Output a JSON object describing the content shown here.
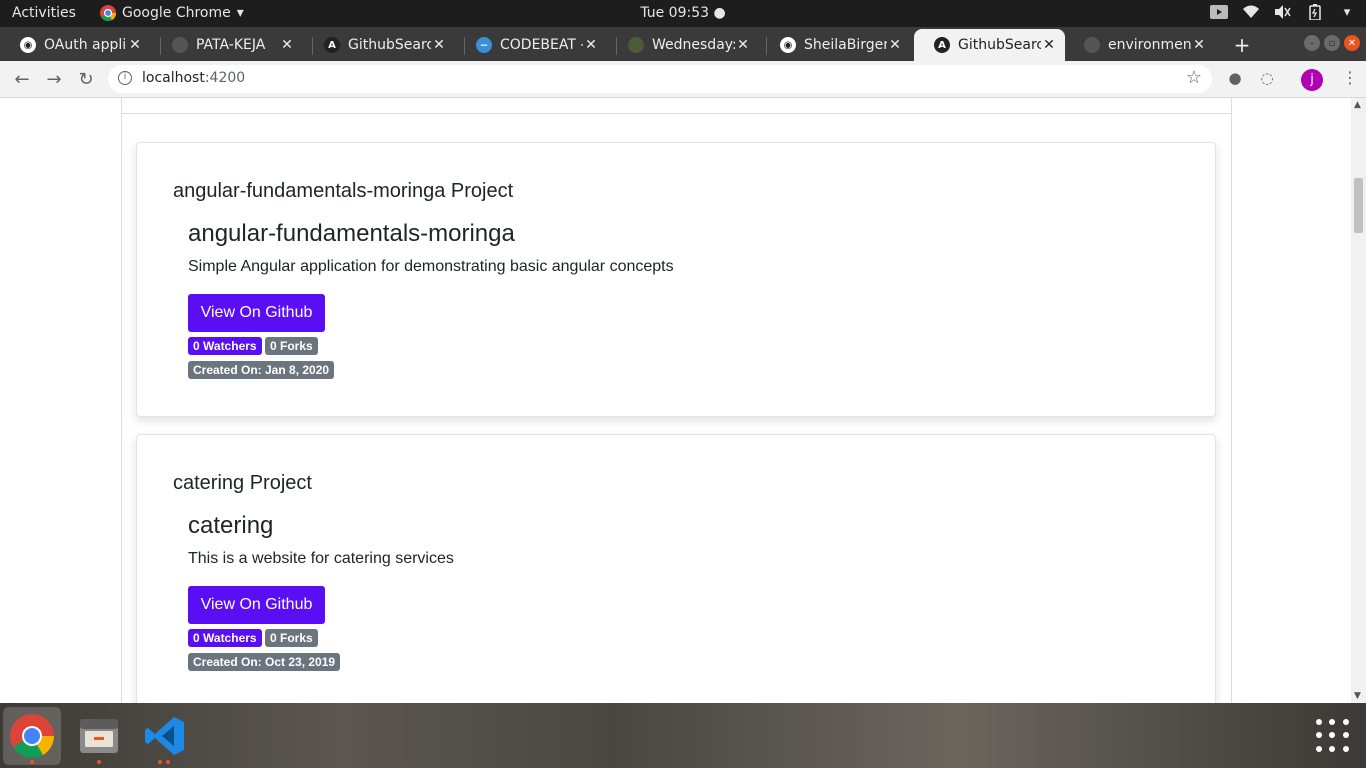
{
  "topbar": {
    "activities": "Activities",
    "app_name": "Google Chrome",
    "clock": "Tue 09:53 ●"
  },
  "tabs": [
    {
      "title": "OAuth applic",
      "favicon": "github-icon",
      "color": "#ffffff"
    },
    {
      "title": "PATA-KEJA",
      "favicon": "blank-icon",
      "color": "#555555"
    },
    {
      "title": "GithubSearch",
      "favicon": "angular-icon",
      "color": "#222222"
    },
    {
      "title": "CODEBEAT -",
      "favicon": "codebeat-icon",
      "color": "#3b8fd6"
    },
    {
      "title": "Wednesday:",
      "favicon": "leaf-icon",
      "color": "#4a5a3a"
    },
    {
      "title": "SheilaBirgen",
      "favicon": "github-icon",
      "color": "#ffffff"
    },
    {
      "title": "GithubSearch",
      "favicon": "angular-icon",
      "color": "#222222",
      "active": true
    },
    {
      "title": "environment",
      "favicon": "blank-icon",
      "color": "#555555"
    }
  ],
  "toolbar": {
    "url_host": "localhost",
    "url_port": ":4200",
    "avatar_letter": "j"
  },
  "projects": [
    {
      "project_title": "angular-fundamentals-moringa Project",
      "repo_name": "angular-fundamentals-moringa",
      "description": "Simple Angular application for demonstrating basic angular concepts",
      "button_label": "View On Github",
      "watchers": "0 Watchers",
      "forks": "0 Forks",
      "created": "Created On: Jan 8, 2020"
    },
    {
      "project_title": "catering Project",
      "repo_name": "catering",
      "description": "This is a website for catering services",
      "button_label": "View On Github",
      "watchers": "0 Watchers",
      "forks": "0 Forks",
      "created": "Created On: Oct 23, 2019"
    }
  ],
  "colors": {
    "accent": "#5a0ef4",
    "badge_grey": "#6c757d",
    "ubuntu_orange": "#e95420"
  },
  "dock": [
    "chrome-icon",
    "files-icon",
    "vscode-icon",
    "show-applications-icon"
  ]
}
